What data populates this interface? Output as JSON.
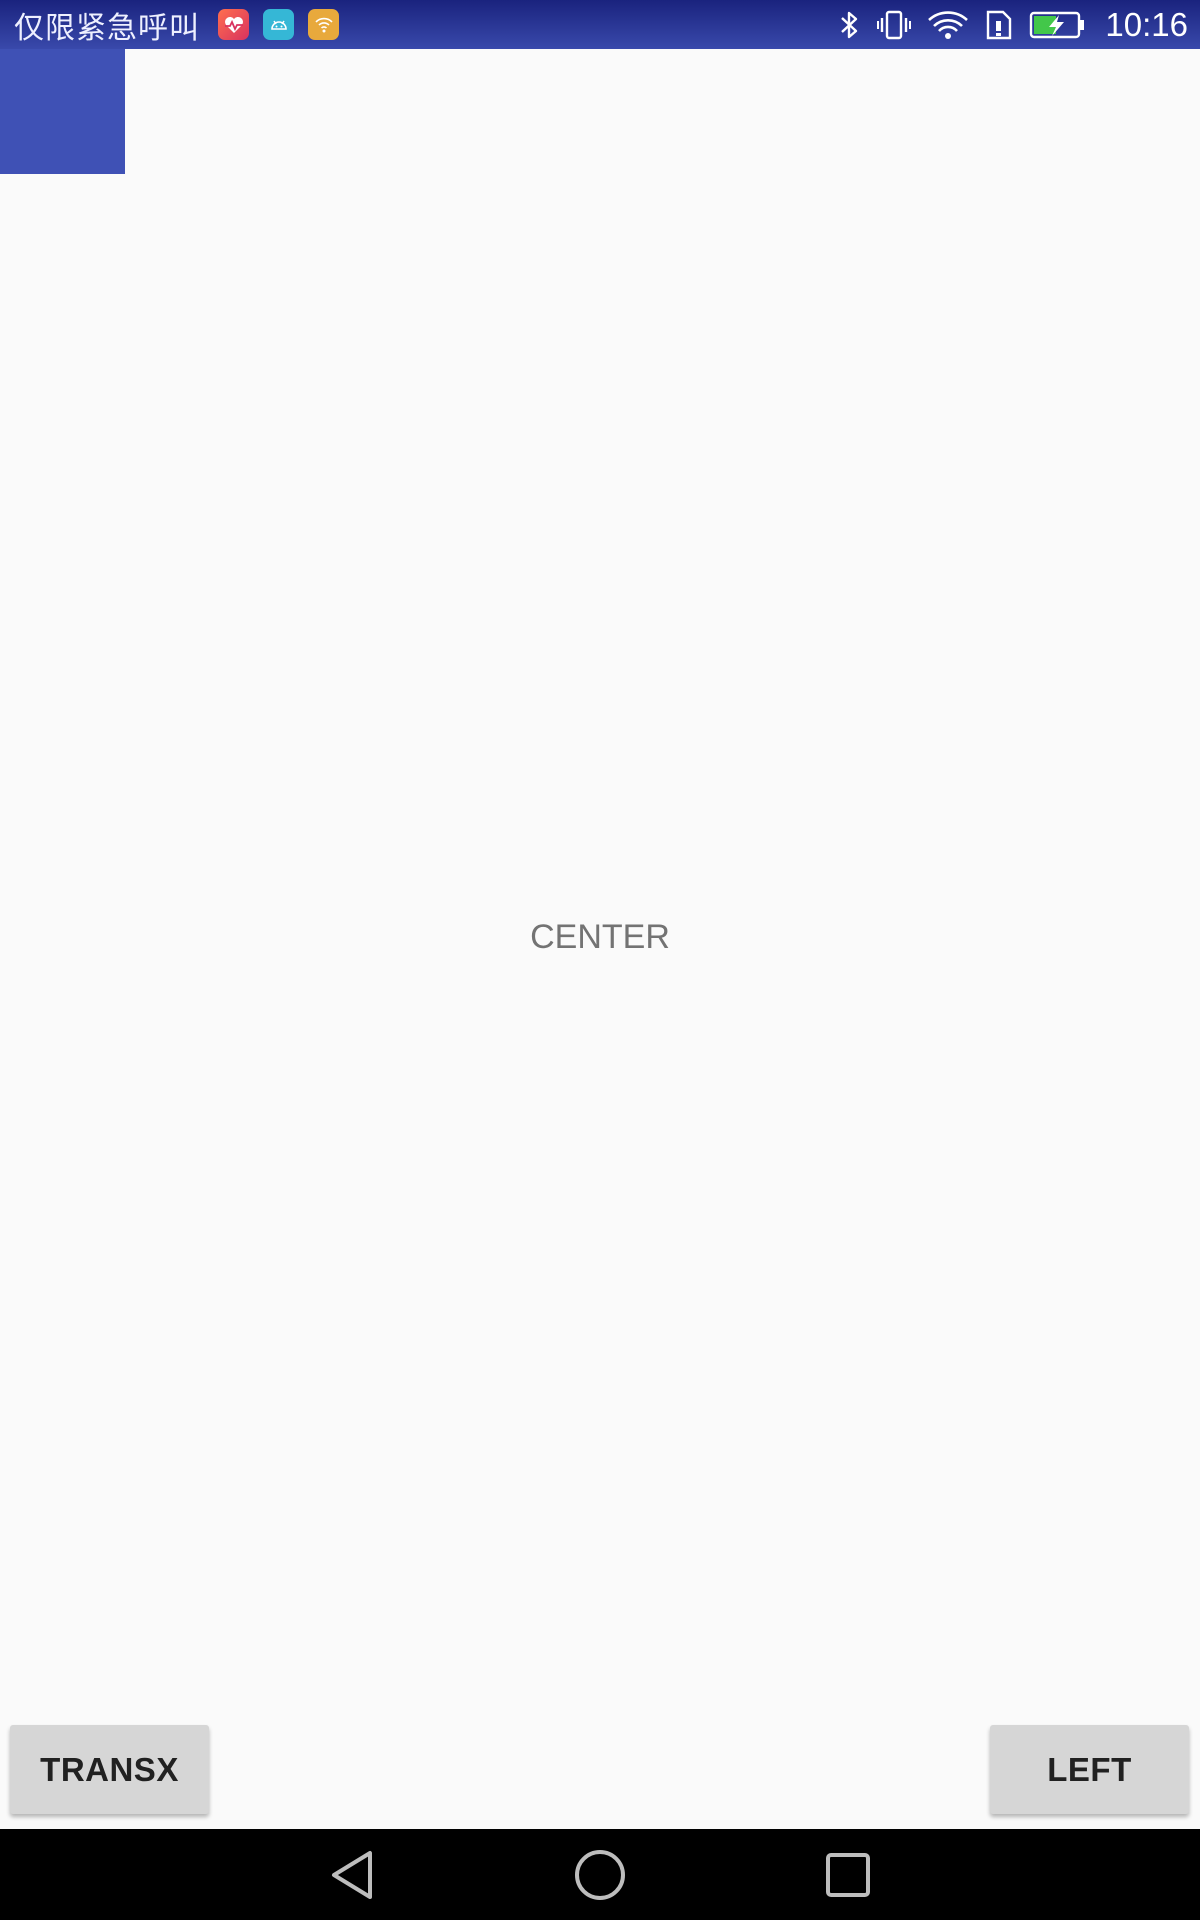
{
  "status_bar": {
    "carrier_text": "仅限紧急呼叫",
    "time": "10:16",
    "notification_icons": [
      "health-app-icon",
      "android-icon",
      "wifi-hotspot-icon"
    ],
    "system_icons": [
      "bluetooth-icon",
      "vibrate-icon",
      "wifi-icon",
      "sim-icon",
      "battery-charging-icon"
    ],
    "background_color": "#283593"
  },
  "main": {
    "center_text": "CENTER",
    "square_color": "#3f51b5"
  },
  "buttons": {
    "transx_label": "TRANSX",
    "left_label": "LEFT"
  },
  "nav_bar": {
    "buttons": [
      "back-icon",
      "home-icon",
      "recents-icon"
    ]
  }
}
